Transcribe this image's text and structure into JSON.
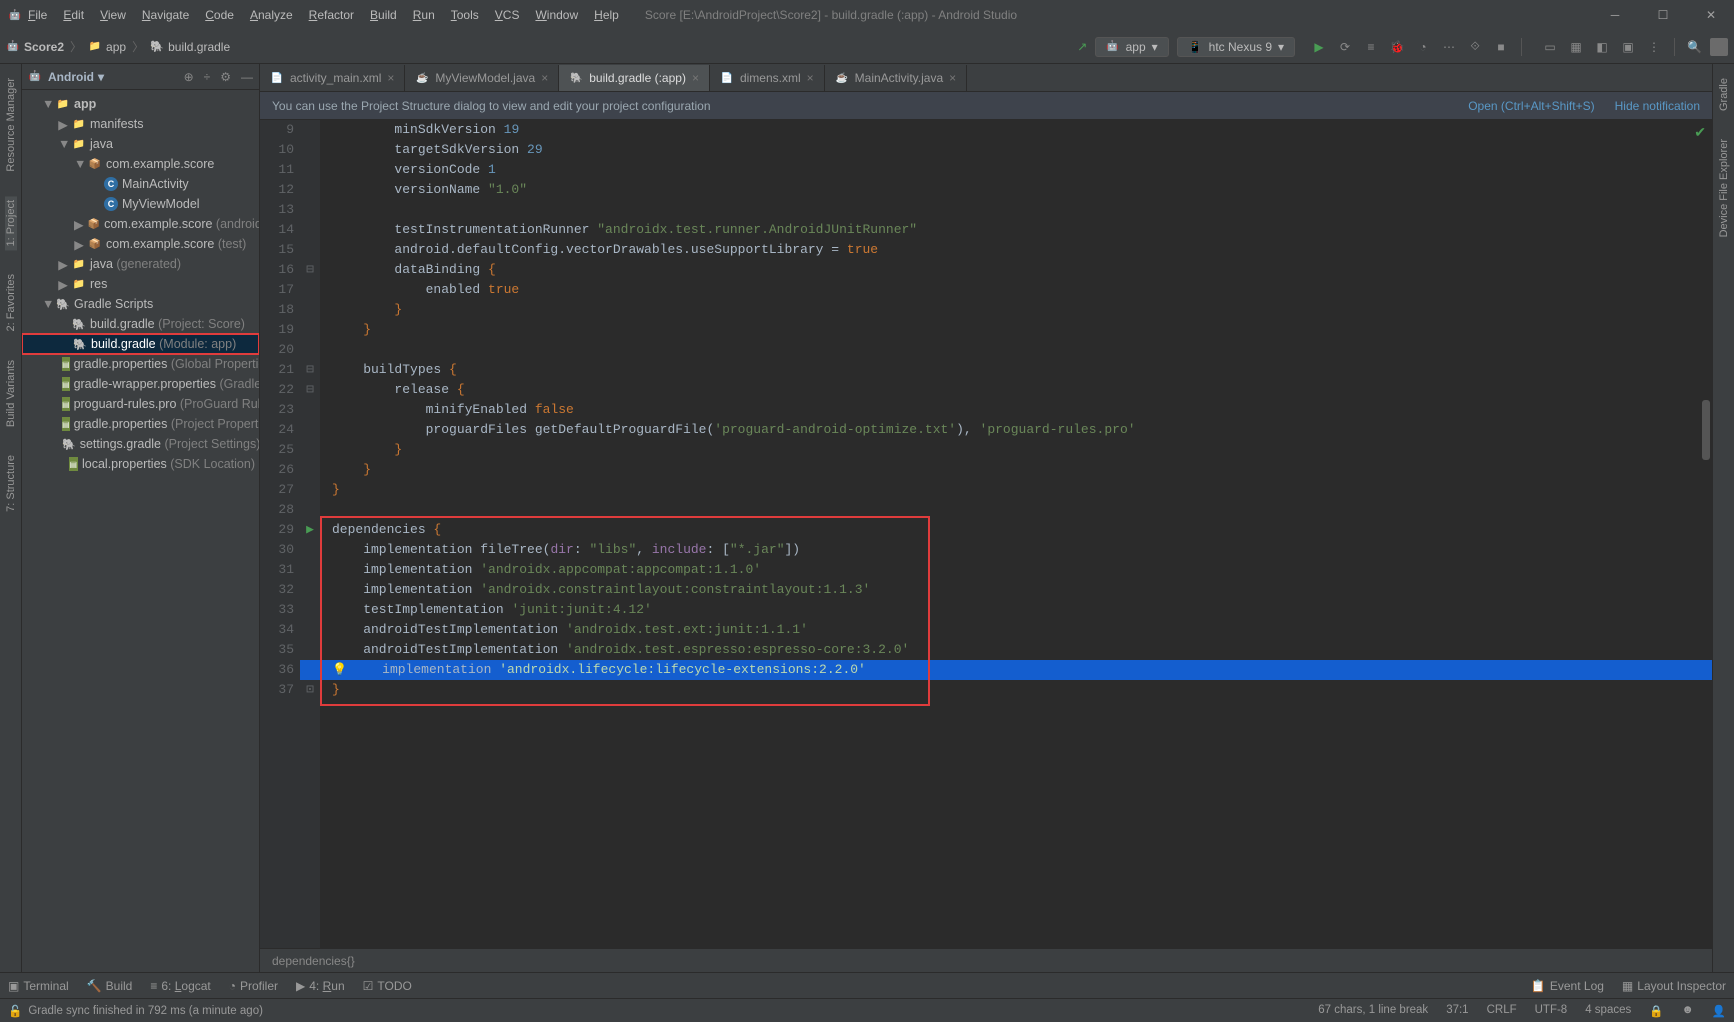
{
  "title_info": "Score [E:\\AndroidProject\\Score2] - build.gradle (:app) - Android Studio",
  "menus": [
    "File",
    "Edit",
    "View",
    "Navigate",
    "Code",
    "Analyze",
    "Refactor",
    "Build",
    "Run",
    "Tools",
    "VCS",
    "Window",
    "Help"
  ],
  "breadcrumb": [
    "Score2",
    "app",
    "build.gradle"
  ],
  "run_config": "app",
  "device_sel": "htc Nexus 9",
  "panel_title": "Android",
  "tree": {
    "root": "app",
    "items": [
      {
        "indent": 1,
        "arrow": "▼",
        "icon": "mod",
        "label": "app",
        "bold": true
      },
      {
        "indent": 2,
        "arrow": "▶",
        "icon": "folder",
        "label": "manifests"
      },
      {
        "indent": 2,
        "arrow": "▼",
        "icon": "folder",
        "label": "java"
      },
      {
        "indent": 3,
        "arrow": "▼",
        "icon": "pkg",
        "label": "com.example.score"
      },
      {
        "indent": 4,
        "arrow": "",
        "icon": "class",
        "label": "MainActivity"
      },
      {
        "indent": 4,
        "arrow": "",
        "icon": "class",
        "label": "MyViewModel"
      },
      {
        "indent": 3,
        "arrow": "▶",
        "icon": "pkg",
        "label": "com.example.score",
        "dim": " (androidTest)"
      },
      {
        "indent": 3,
        "arrow": "▶",
        "icon": "pkg",
        "label": "com.example.score",
        "dim": " (test)"
      },
      {
        "indent": 2,
        "arrow": "▶",
        "icon": "folder2",
        "label": "java",
        "dim": " (generated)"
      },
      {
        "indent": 2,
        "arrow": "▶",
        "icon": "folder",
        "label": "res"
      },
      {
        "indent": 1,
        "arrow": "▼",
        "icon": "gradle",
        "label": "Gradle Scripts"
      },
      {
        "indent": 2,
        "arrow": "",
        "icon": "gradle",
        "label": "build.gradle",
        "dim": " (Project: Score)"
      },
      {
        "indent": 2,
        "arrow": "",
        "icon": "gradle",
        "label": "build.gradle",
        "dim": " (Module: app)",
        "sel": true,
        "hl": true
      },
      {
        "indent": 2,
        "arrow": "",
        "icon": "prop",
        "label": "gradle.properties",
        "dim": " (Global Properties)"
      },
      {
        "indent": 2,
        "arrow": "",
        "icon": "prop",
        "label": "gradle-wrapper.properties",
        "dim": " (Gradle Version)"
      },
      {
        "indent": 2,
        "arrow": "",
        "icon": "prop",
        "label": "proguard-rules.pro",
        "dim": " (ProGuard Rules)"
      },
      {
        "indent": 2,
        "arrow": "",
        "icon": "prop",
        "label": "gradle.properties",
        "dim": " (Project Properties)"
      },
      {
        "indent": 2,
        "arrow": "",
        "icon": "gradle",
        "label": "settings.gradle",
        "dim": " (Project Settings)"
      },
      {
        "indent": 2,
        "arrow": "",
        "icon": "prop",
        "label": "local.properties",
        "dim": " (SDK Location)"
      }
    ]
  },
  "tabs": [
    {
      "icon": "xml",
      "label": "activity_main.xml"
    },
    {
      "icon": "java",
      "label": "MyViewModel.java"
    },
    {
      "icon": "gradle",
      "label": "build.gradle (:app)",
      "active": true
    },
    {
      "icon": "xml",
      "label": "dimens.xml"
    },
    {
      "icon": "java",
      "label": "MainActivity.java"
    }
  ],
  "infobar_text": "You can use the Project Structure dialog to view and edit your project configuration",
  "infobar_link1": "Open (Ctrl+Alt+Shift+S)",
  "infobar_link2": "Hide notification",
  "code_start_line": 9,
  "code_lines": [
    {
      "n": 9,
      "t": "        minSdkVersion |N|19"
    },
    {
      "n": 10,
      "t": "        targetSdkVersion |N|29"
    },
    {
      "n": 11,
      "t": "        versionCode |N|1"
    },
    {
      "n": 12,
      "t": "        versionName |S|\"1.0\""
    },
    {
      "n": 13,
      "t": ""
    },
    {
      "n": 14,
      "t": "        testInstrumentationRunner |S|\"androidx.test.runner.AndroidJUnitRunner\""
    },
    {
      "n": 15,
      "t": "        android.defaultConfig.vectorDrawables.useSupportLibrary = |K|true"
    },
    {
      "n": 16,
      "t": "        dataBinding |K|{"
    },
    {
      "n": 17,
      "t": "            enabled |K|true"
    },
    {
      "n": 18,
      "t": "        |K|}"
    },
    {
      "n": 19,
      "t": "    |K|}"
    },
    {
      "n": 20,
      "t": ""
    },
    {
      "n": 21,
      "t": "    buildTypes |K|{"
    },
    {
      "n": 22,
      "t": "        release |K|{"
    },
    {
      "n": 23,
      "t": "            minifyEnabled |K|false"
    },
    {
      "n": 24,
      "t": "            proguardFiles getDefaultProguardFile(|S|'proguard-android-optimize.txt'|T|), |S|'proguard-rules.pro'"
    },
    {
      "n": 25,
      "t": "        |K|}"
    },
    {
      "n": 26,
      "t": "    |K|}"
    },
    {
      "n": 27,
      "t": "|K|}"
    },
    {
      "n": 28,
      "t": ""
    },
    {
      "n": 29,
      "t": "dependencies |K|{",
      "run": true
    },
    {
      "n": 30,
      "t": "    implementation fileTree(|A|dir|T|: |S|\"libs\"|T|, |A|include|T|: [|S|\"*.jar\"|T|])"
    },
    {
      "n": 31,
      "t": "    implementation |S|'androidx.appcompat:appcompat:1.1.0'"
    },
    {
      "n": 32,
      "t": "    implementation |S|'androidx.constraintlayout:constraintlayout:1.1.3'"
    },
    {
      "n": 33,
      "t": "    testImplementation |S|'junit:junit:4.12'"
    },
    {
      "n": 34,
      "t": "    androidTestImplementation |S|'androidx.test.ext:junit:1.1.1'"
    },
    {
      "n": 35,
      "t": "    androidTestImplementation |S|'androidx.test.espresso:espresso-core:3.2.0'"
    },
    {
      "n": 36,
      "t": "    implementation |S|'androidx.lifecycle:lifecycle-extensions:2.2.0'",
      "hl": true,
      "bulb": true
    },
    {
      "n": 37,
      "t": "|K|}",
      "close": true
    }
  ],
  "crumb": "dependencies{}",
  "bottom_tools": [
    "Terminal",
    "Build",
    "6: Logcat",
    "Profiler",
    "4: Run",
    "TODO"
  ],
  "bottom_right": [
    "Event Log",
    "Layout Inspector"
  ],
  "status_msg": "Gradle sync finished in 792 ms (a minute ago)",
  "status_right": [
    "67 chars, 1 line break",
    "37:1",
    "CRLF",
    "UTF-8",
    "4 spaces"
  ],
  "left_gutter": [
    "Resource Manager",
    "1: Project",
    "2: Favorites",
    "Build Variants",
    "7: Structure"
  ],
  "right_gutter": [
    "Gradle",
    "Device File Explorer"
  ]
}
